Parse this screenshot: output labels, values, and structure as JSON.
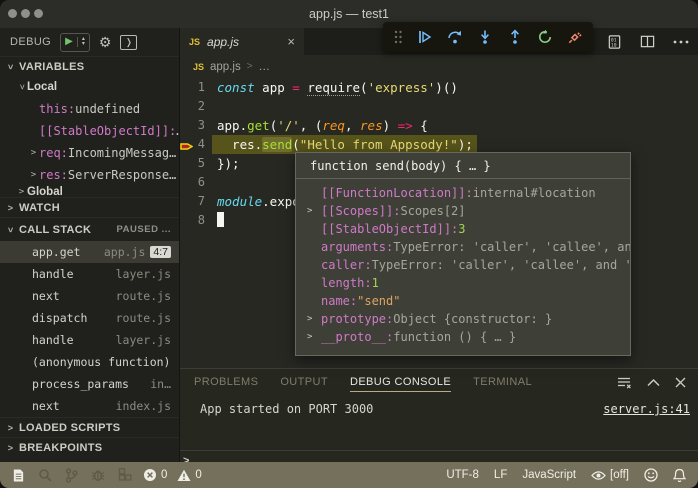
{
  "window": {
    "title": "app.js — test1"
  },
  "sidebar": {
    "header": {
      "title": "DEBUG"
    },
    "variables": {
      "title": "VARIABLES",
      "rows": [
        {
          "kind": "scope",
          "chev": "open",
          "label": "Local"
        },
        {
          "kind": "var",
          "chev": "none",
          "key": "this",
          "sep": ": ",
          "val": "undefined"
        },
        {
          "kind": "var",
          "chev": "none",
          "key": "[[StableObjectId]]",
          "sep": ":",
          "val": "…"
        },
        {
          "kind": "var",
          "chev": "closed",
          "key": "req",
          "sep": ": ",
          "val": "IncomingMessag…"
        },
        {
          "kind": "var",
          "chev": "closed",
          "key": "res",
          "sep": ": ",
          "val": "ServerResponse…"
        },
        {
          "kind": "scope",
          "chev": "closed",
          "label": "Global",
          "clipped": true
        }
      ]
    },
    "watch": {
      "title": "WATCH"
    },
    "call_stack": {
      "title": "CALL STACK",
      "status": "PAUSED ...",
      "frames": [
        {
          "name": "app.get",
          "file": "app.js",
          "badge": "4:7",
          "selected": true
        },
        {
          "name": "handle",
          "file": "layer.js"
        },
        {
          "name": "next",
          "file": "route.js"
        },
        {
          "name": "dispatch",
          "file": "route.js"
        },
        {
          "name": "handle",
          "file": "layer.js"
        },
        {
          "name": "(anonymous function)",
          "file": ""
        },
        {
          "name": "process_params",
          "file": "in…"
        },
        {
          "name": "next",
          "file": "index.js"
        }
      ]
    },
    "loaded_scripts": {
      "title": "LOADED SCRIPTS"
    },
    "breakpoints": {
      "title": "BREAKPOINTS"
    }
  },
  "editor": {
    "tab": {
      "badge": "JS",
      "title": "app.js",
      "close": "×"
    },
    "breadcrumb": {
      "badge": "JS",
      "file": "app.js",
      "sep": ">",
      "more": "…"
    },
    "lines": [
      {
        "n": "1",
        "segs": [
          {
            "t": "const",
            "c": "kw"
          },
          {
            "t": " app ",
            "c": "pl"
          },
          {
            "t": "=",
            "c": "op"
          },
          {
            "t": " ",
            "c": "pl"
          },
          {
            "t": "require",
            "c": "pl u"
          },
          {
            "t": "(",
            "c": "pl"
          },
          {
            "t": "'express'",
            "c": "str"
          },
          {
            "t": ")()",
            "c": "pl"
          }
        ]
      },
      {
        "n": "2",
        "segs": []
      },
      {
        "n": "3",
        "segs": [
          {
            "t": "app.",
            "c": "pl"
          },
          {
            "t": "get",
            "c": "fn"
          },
          {
            "t": "(",
            "c": "pl"
          },
          {
            "t": "'/'",
            "c": "str"
          },
          {
            "t": ", (",
            "c": "pl"
          },
          {
            "t": "req",
            "c": "param"
          },
          {
            "t": ", ",
            "c": "pl"
          },
          {
            "t": "res",
            "c": "param"
          },
          {
            "t": ") ",
            "c": "pl"
          },
          {
            "t": "=>",
            "c": "op"
          },
          {
            "t": " {",
            "c": "pl"
          }
        ]
      },
      {
        "n": "4",
        "current": true,
        "segs": [
          {
            "t": "  res.",
            "c": "pl"
          },
          {
            "t": "send",
            "c": "fn hov"
          },
          {
            "t": "(",
            "c": "pl"
          },
          {
            "t": "\"Hello from Appsody!\"",
            "c": "str"
          },
          {
            "t": ");",
            "c": "pl"
          }
        ]
      },
      {
        "n": "5",
        "segs": [
          {
            "t": "});",
            "c": "pl"
          }
        ]
      },
      {
        "n": "6",
        "segs": []
      },
      {
        "n": "7",
        "segs": [
          {
            "t": "module",
            "c": "kw"
          },
          {
            "t": ".exports",
            "c": "pl"
          }
        ]
      },
      {
        "n": "8",
        "cursor": true,
        "segs": []
      }
    ]
  },
  "debug_toolbar": {
    "icons": [
      "drag-handle",
      "continue",
      "step-over",
      "step-into",
      "step-out",
      "restart",
      "disconnect"
    ]
  },
  "editor_actions": {
    "icons": [
      "binary-file",
      "split-editor",
      "more-actions"
    ]
  },
  "hover": {
    "signature": "function send(body) { … }",
    "rows": [
      {
        "chev": "none",
        "key": "[[FunctionLocation]]:",
        "val": "internal#location",
        "vc": "dim"
      },
      {
        "chev": "closed",
        "key": "[[Scopes]]:",
        "val": "Scopes[2]",
        "vc": "dim"
      },
      {
        "chev": "none",
        "key": "[[StableObjectId]]:",
        "val": "3",
        "vc": "num"
      },
      {
        "chev": "none",
        "key": "arguments:",
        "val": "TypeError: 'caller', 'callee', and",
        "vc": "dim"
      },
      {
        "chev": "none",
        "key": "caller:",
        "val": "TypeError: 'caller', 'callee', and 'a",
        "vc": "dim"
      },
      {
        "chev": "none",
        "key": "length:",
        "val": "1",
        "vc": "num"
      },
      {
        "chev": "none",
        "key": "name:",
        "val": "\"send\"",
        "vc": "str"
      },
      {
        "chev": "closed",
        "key": "prototype:",
        "val": "Object {constructor: }",
        "vc": "dim"
      },
      {
        "chev": "closed",
        "key": "__proto__:",
        "val": "function () { … }",
        "vc": "dim"
      }
    ]
  },
  "panel": {
    "tabs": [
      {
        "label": "PROBLEMS"
      },
      {
        "label": "OUTPUT"
      },
      {
        "label": "DEBUG CONSOLE",
        "active": true
      },
      {
        "label": "TERMINAL"
      }
    ],
    "icons": [
      "clear-console",
      "maximize-panel",
      "close-panel"
    ],
    "log": "App started on PORT 3000",
    "link": "server.js:41",
    "prompt": ">"
  },
  "status_bar": {
    "left_icons": [
      "file",
      "search",
      "source-control",
      "debug",
      "extensions"
    ],
    "errors": "0",
    "warnings": "0",
    "encoding": "UTF-8",
    "eol": "LF",
    "language": "JavaScript",
    "eye_label": "[off]"
  },
  "colors": {
    "accent_blue": "#75beff",
    "accent_green": "#89d185",
    "accent_red": "#f48771",
    "status_bar_bg": "#75705c",
    "debug_line_bg": "#56531b",
    "editor_bg": "#272822",
    "string_yellow": "#e6db74",
    "keyword_cyan": "#66d9ef",
    "operator_pink": "#f92672",
    "function_green": "#a6e22e"
  }
}
